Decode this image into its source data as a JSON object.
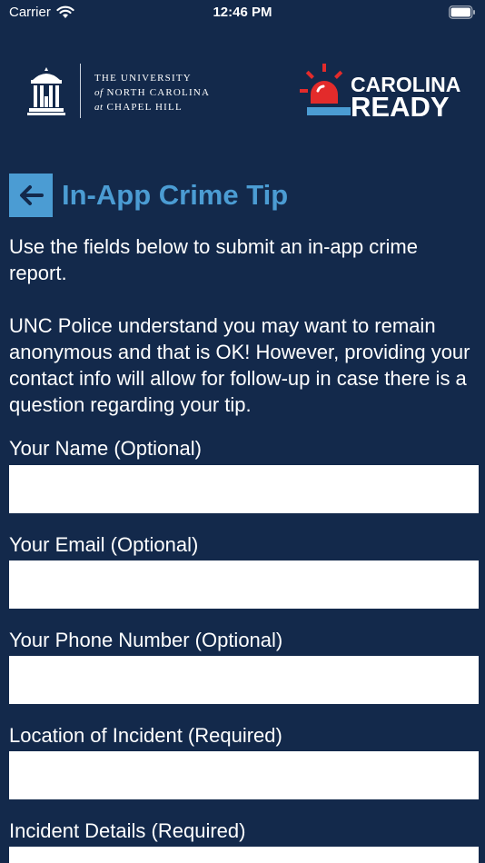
{
  "status_bar": {
    "carrier": "Carrier",
    "time": "12:46 PM"
  },
  "header": {
    "unc_logo": {
      "line1": "THE UNIVERSITY",
      "line2_prefix": "of",
      "line2": "NORTH CAROLINA",
      "line3_prefix": "at",
      "line3": "CHAPEL HILL"
    },
    "carolina_ready_logo": {
      "line1": "CAROLINA",
      "line2": "READY"
    }
  },
  "page": {
    "title": "In-App Crime Tip",
    "intro_1": "Use the fields below to submit an in-app crime report.",
    "intro_2": "UNC Police understand you may want to remain anonymous and that is OK! However, providing your contact info will allow for follow-up in case there is a question regarding your tip."
  },
  "form": {
    "fields": [
      {
        "label": "Your Name (Optional)",
        "value": ""
      },
      {
        "label": "Your Email (Optional)",
        "value": ""
      },
      {
        "label": "Your Phone Number (Optional)",
        "value": ""
      },
      {
        "label": "Location of Incident (Required)",
        "value": ""
      },
      {
        "label": "Incident Details (Required)",
        "value": ""
      }
    ]
  },
  "colors": {
    "background": "#13294b",
    "accent": "#4b9cd3",
    "siren_red": "#e32b2b"
  },
  "icons": [
    "wifi-icon",
    "battery-icon",
    "old-well-icon",
    "siren-icon",
    "arrow-left-icon"
  ]
}
